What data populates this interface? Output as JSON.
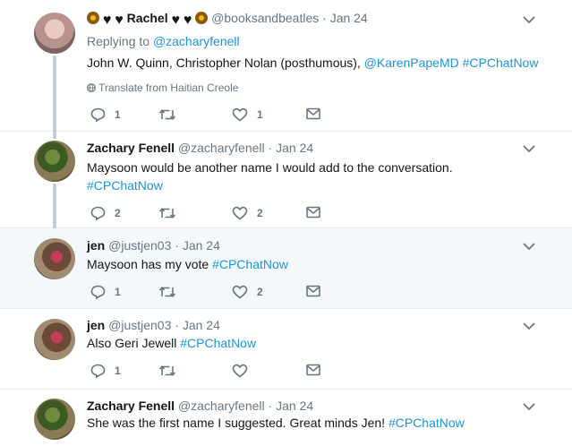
{
  "tweets": [
    {
      "name_parts": {
        "emoji_left": [
          "sunflower-emoji",
          "black-heart-emoji",
          "black-heart-emoji"
        ],
        "name": "Rachel",
        "emoji_right": [
          "black-heart-emoji",
          "black-heart-emoji",
          "sunflower-emoji"
        ]
      },
      "handle": "@booksandbeatles",
      "dot": "·",
      "date": "Jan 24",
      "replying_label": "Replying to ",
      "replying_handle": "@zacharyfenell",
      "text_plain": "John W. Quinn, Christopher Nolan (posthumous), ",
      "text_link1": "@KarenPapeMD",
      "text_space": " ",
      "text_link2": "#CPChatNow",
      "translate": "Translate from Haitian Creole",
      "reply_count": "1",
      "retweet_count": "",
      "like_count": "1"
    },
    {
      "name": "Zachary Fenell",
      "handle": "@zacharyfenell",
      "dot": "·",
      "date": "Jan 24",
      "line1": "Maysoon would be another name I would add to the conversation.",
      "line2_link": "#CPChatNow",
      "reply_count": "2",
      "retweet_count": "",
      "like_count": "2"
    },
    {
      "name": "jen",
      "handle": "@justjen03",
      "dot": "·",
      "date": "Jan 24",
      "text_plain": "Maysoon has my vote ",
      "text_link": "#CPChatNow",
      "reply_count": "1",
      "retweet_count": "",
      "like_count": "2"
    },
    {
      "name": "jen",
      "handle": "@justjen03",
      "dot": "·",
      "date": "Jan 24",
      "text_plain": "Also Geri Jewell ",
      "text_link": "#CPChatNow",
      "reply_count": "1",
      "retweet_count": "",
      "like_count": ""
    },
    {
      "name": "Zachary Fenell",
      "handle": "@zacharyfenell",
      "dot": "·",
      "date": "Jan 24",
      "text_plain": "She was the first name I suggested. Great minds Jen! ",
      "text_link": "#CPChatNow"
    }
  ],
  "colors": {
    "link": "#1b95e0",
    "muted": "#657786",
    "highlight_bg": "#f5f8fa",
    "thread_line": "#c4cfd6"
  },
  "icons": [
    "reply-icon",
    "retweet-icon",
    "like-icon",
    "direct-message-icon",
    "chevron-down-icon",
    "globe-icon"
  ]
}
